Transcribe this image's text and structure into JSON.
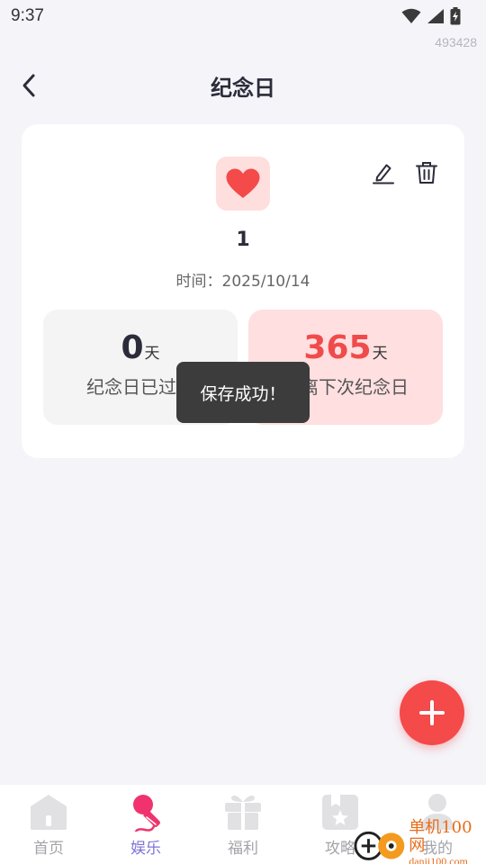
{
  "status_bar": {
    "time": "9:37"
  },
  "device_id": "493428",
  "header": {
    "title": "纪念日"
  },
  "anniversary": {
    "name": "1",
    "date_text": "时间：2025/10/14",
    "passed": {
      "value": "0",
      "unit": "天",
      "caption": "纪念日已过去"
    },
    "next": {
      "value": "365",
      "unit": "天",
      "caption": "距离下次纪念日"
    }
  },
  "toast": "保存成功！",
  "tabbar": {
    "tabs": [
      {
        "label": "首页",
        "icon": "home-icon",
        "active": false
      },
      {
        "label": "娱乐",
        "icon": "microphone-icon",
        "active": true
      },
      {
        "label": "福利",
        "icon": "gift-icon",
        "active": false
      },
      {
        "label": "攻略",
        "icon": "guide-icon",
        "active": false
      },
      {
        "label": "我的",
        "icon": "user-icon",
        "active": false
      }
    ]
  },
  "watermark": {
    "name": "单机100网",
    "url": "danji100.com"
  },
  "colors": {
    "accent_red": "#f44a4a",
    "active_tab": "#7b74d8",
    "page_bg": "#f4f4f9"
  }
}
